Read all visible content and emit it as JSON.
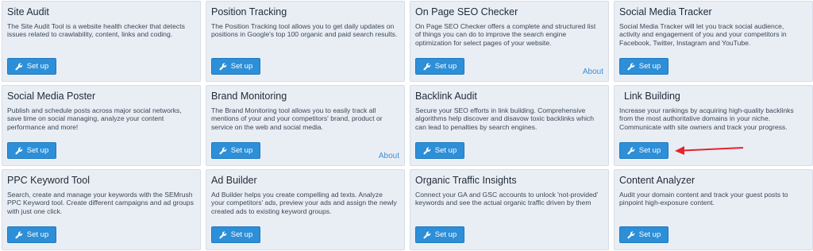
{
  "cards": [
    {
      "title": "Site Audit",
      "desc": "The Site Audit Tool is a website health checker that detects issues related to crawlability, content, links and coding.",
      "button": "Set up"
    },
    {
      "title": "Position Tracking",
      "desc": "The Position Tracking tool allows you to get daily updates on positions in Google's top 100 organic and paid search results.",
      "button": "Set up"
    },
    {
      "title": "On Page SEO Checker",
      "desc": "On Page SEO Checker offers a complete and structured list of things you can do to improve the search engine optimization for select pages of your website.",
      "button": "Set up",
      "link": "About"
    },
    {
      "title": "Social Media Tracker",
      "desc": "Social Media Tracker will let you track social audience, activity and engagement of you and your competitors in Facebook, Twitter, Instagram and YouTube.",
      "button": "Set up"
    },
    {
      "title": "Social Media Poster",
      "desc": "Publish and schedule posts across major social networks, save time on social managing, analyze your content performance and more!",
      "button": "Set up"
    },
    {
      "title": "Brand Monitoring",
      "desc": "The Brand Monitoring tool allows you to easily track all mentions of your and your competitors' brand, product or service on the web and social media.",
      "button": "Set up",
      "link": "About"
    },
    {
      "title": "Backlink Audit",
      "desc": "Secure your SEO efforts in link building. Comprehensive algorithms help discover and disavow toxic backlinks which can lead to penalties by search engines.",
      "button": "Set up"
    },
    {
      "title": "Link Building",
      "desc": "Increase your rankings by acquiring high-quality backlinks from the most authoritative domains in your niche. Communicate with site owners and track your progress.",
      "button": "Set up"
    },
    {
      "title": "PPC Keyword Tool",
      "desc": "Search, create and manage your keywords with the SEMrush PPC Keyword tool. Create different campaigns and ad groups with just one click.",
      "button": "Set up"
    },
    {
      "title": "Ad Builder",
      "desc": "Ad Builder helps you create compelling ad texts. Analyze your competitors' ads, preview your ads and assign the newly created ads to existing keyword groups.",
      "button": "Set up"
    },
    {
      "title": "Organic Traffic Insights",
      "desc": "Connect your GA and GSC accounts to unlock 'not-provided' keywords and see the actual organic traffic driven by them",
      "button": "Set up"
    },
    {
      "title": "Content Analyzer",
      "desc": "Audit your domain content and track your guest posts to pinpoint high-exposure content.",
      "button": "Set up"
    }
  ],
  "colors": {
    "button": "#2d8fd8",
    "card": "#e9eef5",
    "arrow": "#e8222a",
    "link": "#3b8fd4"
  },
  "icons": {
    "button_icon": "wrench-icon"
  }
}
